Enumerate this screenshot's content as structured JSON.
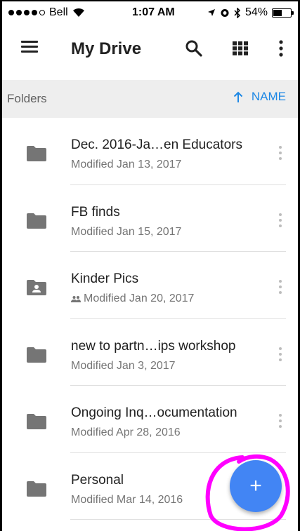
{
  "status_bar": {
    "carrier": "Bell",
    "time": "1:07 AM",
    "battery": "54%",
    "battery_level": 0.54
  },
  "app_bar": {
    "title": "My Drive",
    "icons": [
      "menu-icon",
      "search-icon",
      "grid-view-icon",
      "more-vert-icon"
    ]
  },
  "list_header": {
    "section_label": "Folders",
    "sort_label": "NAME",
    "sort_icon": "arrow-up-icon"
  },
  "folders": [
    {
      "name": "Dec. 2016-Ja…en Educators",
      "modified": "Modified Jan 13, 2017",
      "shared": false
    },
    {
      "name": "FB finds",
      "modified": "Modified Jan 15, 2017",
      "shared": false
    },
    {
      "name": "Kinder Pics",
      "modified": "Modified Jan 20, 2017",
      "shared": true
    },
    {
      "name": "new to partn…ips workshop",
      "modified": "Modified Jan 3, 2017",
      "shared": false
    },
    {
      "name": "Ongoing Inq…ocumentation",
      "modified": "Modified Apr 28, 2016",
      "shared": false
    },
    {
      "name": "Personal",
      "modified": "Modified Mar 14, 2016",
      "shared": false
    }
  ],
  "fab": {
    "label": "+",
    "icon": "plus-icon"
  },
  "colors": {
    "accent": "#1e88e5",
    "fab": "#4285f4",
    "header_bg": "#eeeeee",
    "annotation": "#ff00ff"
  }
}
